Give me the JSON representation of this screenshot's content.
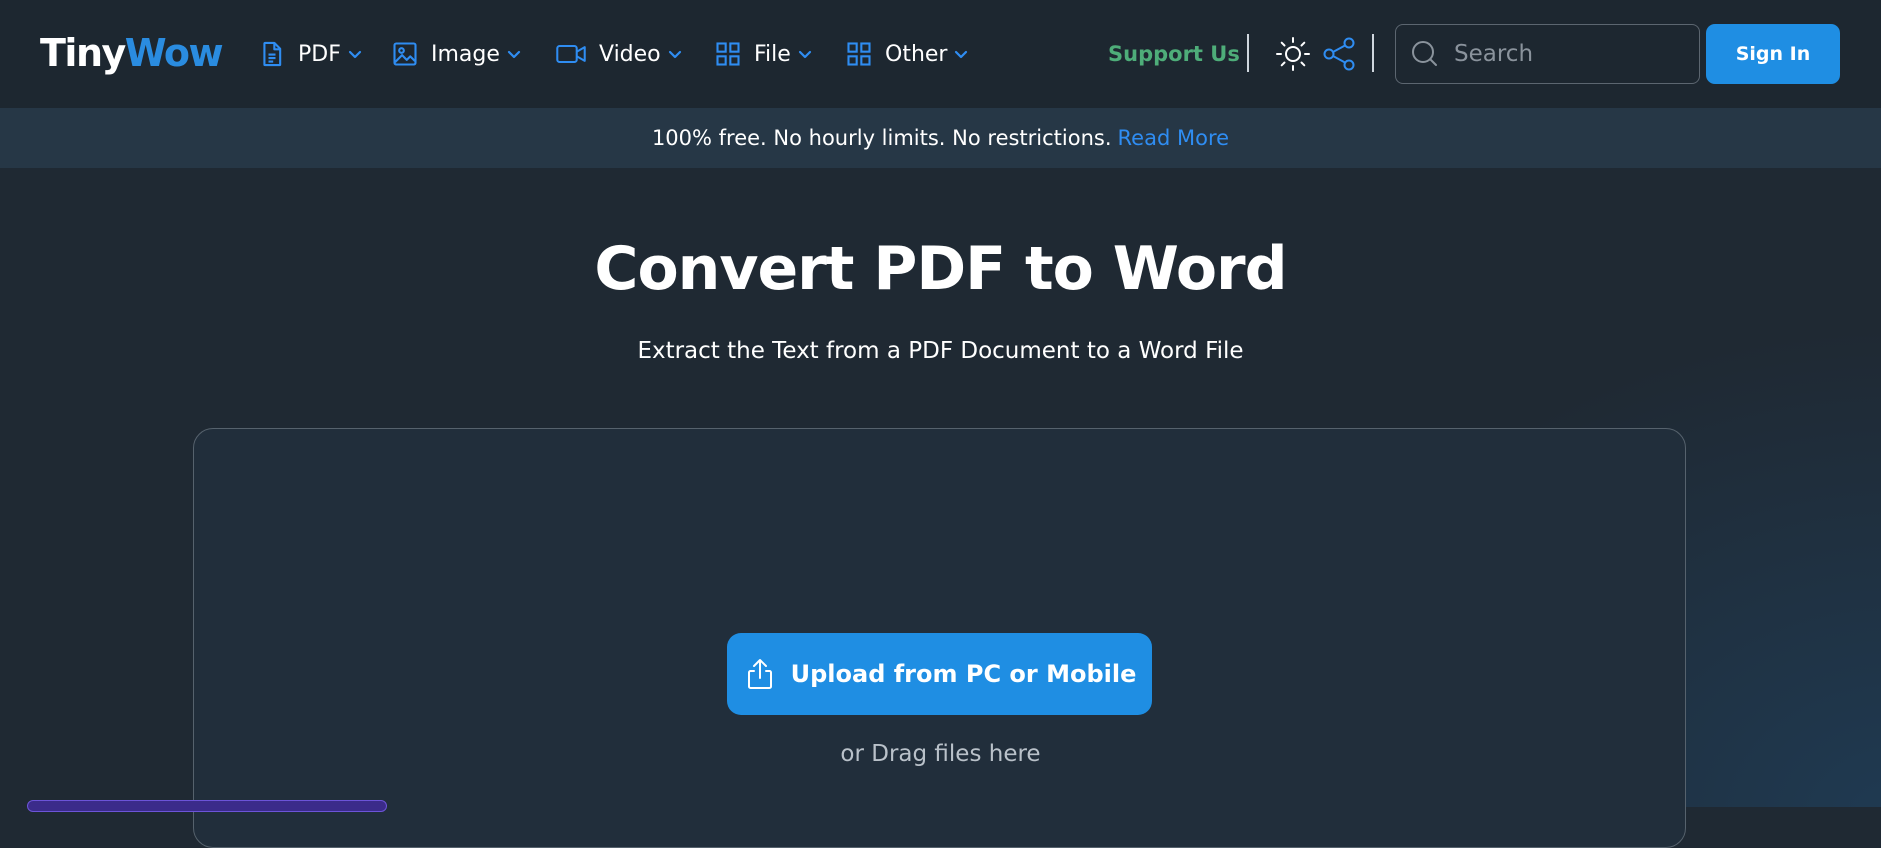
{
  "logo": {
    "part1": "Tiny",
    "part2": "Wow"
  },
  "nav": {
    "items": [
      {
        "label": "PDF",
        "icon": "pdf-file-icon"
      },
      {
        "label": "Image",
        "icon": "image-icon"
      },
      {
        "label": "Video",
        "icon": "video-camera-icon"
      },
      {
        "label": "File",
        "icon": "grid-icon"
      },
      {
        "label": "Other",
        "icon": "grid-icon"
      }
    ],
    "support_label": "Support Us",
    "search_placeholder": "Search",
    "signin_label": "Sign In"
  },
  "banner": {
    "text": "100% free. No hourly limits. No restrictions.",
    "link": "Read More"
  },
  "main": {
    "title": "Convert PDF to Word",
    "subtitle": "Extract the Text from a PDF Document to a Word File",
    "upload_label": "Upload from PC or Mobile",
    "drag_text": "or Drag files here"
  },
  "colors": {
    "accent": "#1f8ee3",
    "logo_accent": "#2a8ce0",
    "support": "#4ead79",
    "link": "#2f8df2",
    "background": "#1f2933"
  }
}
